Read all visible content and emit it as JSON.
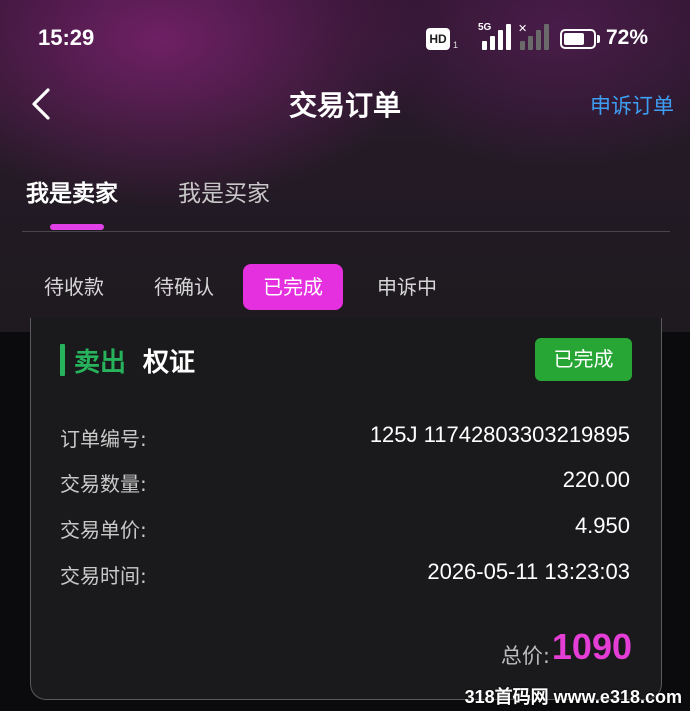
{
  "status_bar": {
    "time": "15:29",
    "hd_badge": "HD",
    "hd_sub": "1",
    "network": "5G",
    "battery_percent": "72%",
    "battery_level": 0.72
  },
  "nav": {
    "title": "交易订单",
    "appeal_link": "申诉订单"
  },
  "role_tabs": [
    {
      "label": "我是卖家",
      "active": true
    },
    {
      "label": "我是买家",
      "active": false
    }
  ],
  "status_tabs": [
    {
      "label": "待收款",
      "active": false
    },
    {
      "label": "待确认",
      "active": false
    },
    {
      "label": "已完成",
      "active": true
    },
    {
      "label": "申诉中",
      "active": false
    }
  ],
  "order": {
    "side": "卖出",
    "asset": "权证",
    "status_badge": "已完成",
    "rows": [
      {
        "label": "订单编号:",
        "value": "125J 11742803303219895"
      },
      {
        "label": "交易数量:",
        "value": "220.00"
      },
      {
        "label": "交易单价:",
        "value": "4.950"
      },
      {
        "label": "交易时间:",
        "value": "2026-05-11 13:23:03"
      }
    ],
    "total_label": "总价:",
    "total_value": "1090"
  },
  "watermark": "318首码网 www.e318.com",
  "colors": {
    "accent": "#e430df",
    "side_green": "#27b35b",
    "badge_green": "#27a635",
    "link_blue": "#3e9ef2",
    "total_pink": "#e53ed6"
  }
}
